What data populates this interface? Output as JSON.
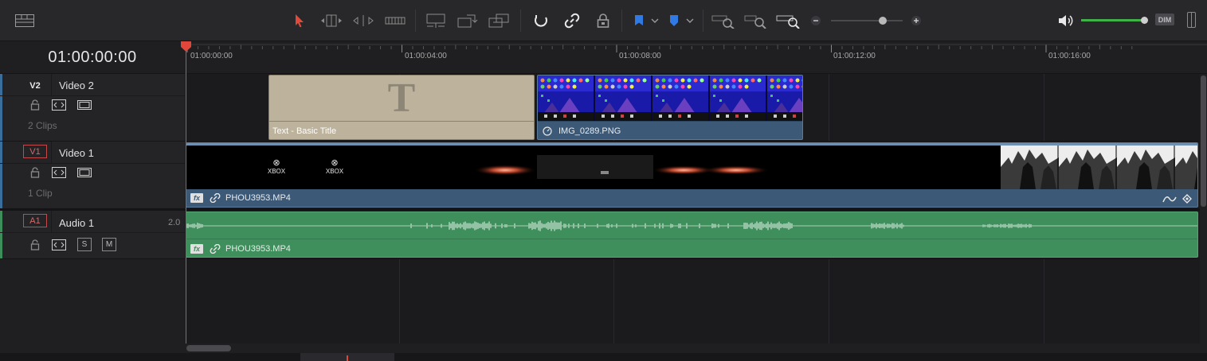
{
  "toolbar": {
    "left_icon": "timeline-view-options-icon",
    "tools": [
      "selection-mode-icon",
      "trim-edit-mode-icon",
      "dynamic-trim-mode-icon",
      "blade-edit-mode-icon",
      "insert-clip-icon",
      "overwrite-clip-icon",
      "replace-clip-icon",
      "snapping-icon",
      "linked-selection-icon",
      "position-lock-icon",
      "flag-icon",
      "marker-icon",
      "zoom-full-icon",
      "zoom-detail-icon",
      "zoom-custom-icon"
    ],
    "zoom_level": 0.72,
    "volume_level": 0.96,
    "dim_label": "DIM",
    "accent_select": "#e04a3a",
    "flag_color": "#2f7ae5",
    "marker_color": "#2f7ae5",
    "volume_color": "#3fb24a"
  },
  "timecode": "01:00:00:00",
  "ruler": {
    "labels": [
      "01:00:00:00",
      "01:00:04:00",
      "01:00:08:00",
      "01:00:12:00",
      "01:00:16:00"
    ]
  },
  "tracks": {
    "v2": {
      "id": "V2",
      "name": "Video 2",
      "clips": "2 Clips",
      "color": "#3a6e9c"
    },
    "v1": {
      "id": "V1",
      "name": "Video 1",
      "clips": "1 Clip",
      "color": "#3a6e9c"
    },
    "a1": {
      "id": "A1",
      "name": "Audio 1",
      "channels": "2.0",
      "solo": "S",
      "mute": "M",
      "color": "#3d8e5a"
    }
  },
  "clips": {
    "title_clip": {
      "label": "Text - Basic Title",
      "glyph": "T",
      "color": "#bdb39c"
    },
    "image_clip": {
      "label": "IMG_0289.PNG",
      "color": "#3c5a78"
    },
    "video_clip": {
      "label": "PHOU3953.MP4",
      "fx": "fx",
      "color": "#3c5a78",
      "frame_text": "XBOX"
    },
    "audio_clip": {
      "label": "PHOU3953.MP4",
      "fx": "fx",
      "color": "#3f8f5d"
    }
  },
  "playhead_color": "#e0463a"
}
